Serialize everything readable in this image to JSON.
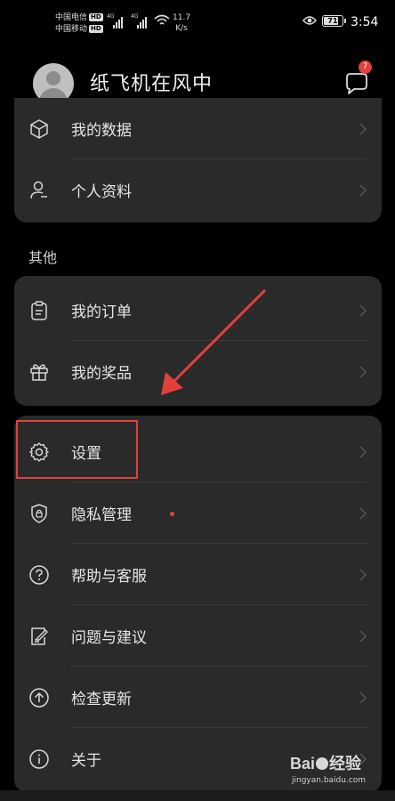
{
  "status_bar": {
    "carrier_1": "中国电信",
    "carrier_2": "中国移动",
    "hd": "HD",
    "net_1": "4G",
    "net_2": "4G",
    "speed_value": "11.7",
    "speed_unit": "K/s",
    "battery": "71",
    "time": "3:54"
  },
  "header": {
    "username": "纸飞机在风中",
    "message_badge": "7"
  },
  "menu": {
    "group_1": [
      {
        "label": "我的数据",
        "icon": "cube-icon"
      },
      {
        "label": "个人资料",
        "icon": "person-icon"
      }
    ],
    "section_title": "其他",
    "group_2": [
      {
        "label": "我的订单",
        "icon": "clipboard-icon"
      },
      {
        "label": "我的奖品",
        "icon": "gift-icon"
      }
    ],
    "group_3": [
      {
        "label": "设置",
        "icon": "gear-icon"
      },
      {
        "label": "隐私管理",
        "icon": "shield-lock-icon"
      },
      {
        "label": "帮助与客服",
        "icon": "question-icon"
      },
      {
        "label": "问题与建议",
        "icon": "edit-note-icon"
      },
      {
        "label": "检查更新",
        "icon": "arrow-up-circle-icon"
      },
      {
        "label": "关于",
        "icon": "info-icon"
      }
    ]
  },
  "watermark": {
    "logo_left": "Bai",
    "logo_right": "经验",
    "url": "jingyan.baidu.com"
  },
  "colors": {
    "background": "#000000",
    "card": "#2a2a2b",
    "accent_red": "#e2403b",
    "text": "#e6e6e6"
  }
}
